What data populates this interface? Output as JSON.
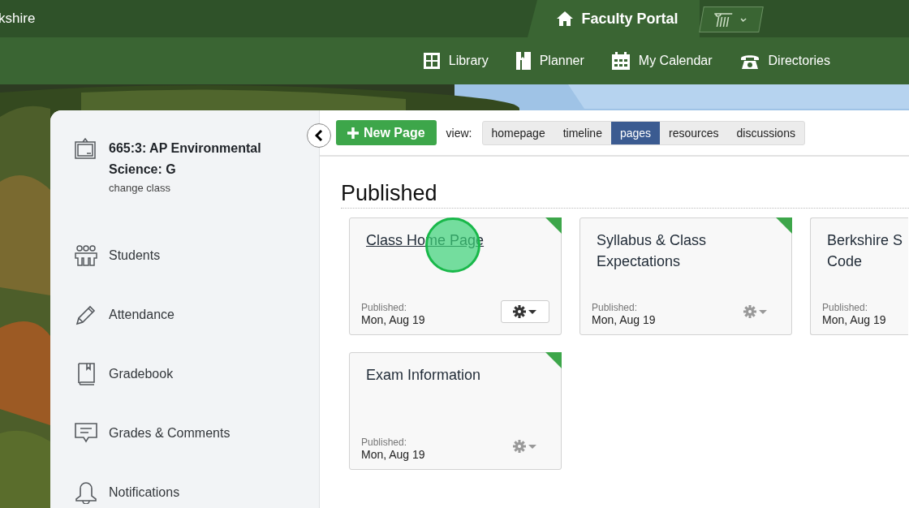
{
  "header": {
    "site_title": "kshire",
    "portal_tab": "Faculty Portal"
  },
  "nav": [
    {
      "label": "Library",
      "kind": "library"
    },
    {
      "label": "Planner",
      "kind": "planner"
    },
    {
      "label": "My Calendar",
      "kind": "calendar"
    },
    {
      "label": "Directories",
      "kind": "directory"
    }
  ],
  "sidebar": {
    "class_title": "665:3: AP Environmental Science: G",
    "change_link": "change class",
    "items": [
      {
        "label": "Students",
        "kind": "students"
      },
      {
        "label": "Attendance",
        "kind": "attendance"
      },
      {
        "label": "Gradebook",
        "kind": "gradebook"
      },
      {
        "label": "Grades & Comments",
        "kind": "comments"
      },
      {
        "label": "Notifications",
        "kind": "notifications"
      }
    ]
  },
  "toolbar": {
    "new_button": "New Page",
    "view_label": "view:",
    "views": [
      {
        "label": "homepage",
        "selected": false
      },
      {
        "label": "timeline",
        "selected": false
      },
      {
        "label": "pages",
        "selected": true
      },
      {
        "label": "resources",
        "selected": false
      },
      {
        "label": "discussions",
        "selected": false
      }
    ]
  },
  "section_title": "Published",
  "cards": [
    [
      {
        "title": "Class Home Page",
        "status_label": "Published:",
        "date": "Mon, Aug 19",
        "hovered": true,
        "cut_off": false
      },
      {
        "title": "Syllabus & Class Expectations",
        "status_label": "Published:",
        "date": "Mon, Aug 19",
        "hovered": false,
        "cut_off": false
      },
      {
        "title": "Berkshire S Code",
        "status_label": "Published:",
        "date": "Mon, Aug 19",
        "hovered": false,
        "cut_off": true
      }
    ],
    [
      {
        "title": "Exam Information",
        "status_label": "Published:",
        "date": "Mon, Aug 19",
        "hovered": false,
        "cut_off": false
      }
    ]
  ]
}
